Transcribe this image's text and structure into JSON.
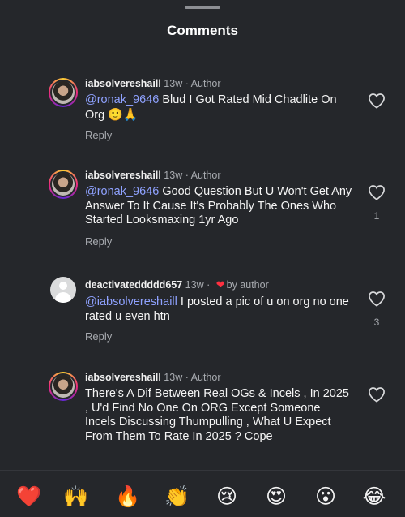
{
  "header": {
    "title": "Comments"
  },
  "comments": [
    {
      "user": "iabsolvereshaill",
      "time": "13w",
      "sep": " · ",
      "badge": "Author",
      "mention": "@ronak_9646",
      "body": " Blud I Got Rated Mid Chadlite On Org ",
      "emoji": "🙂🙏",
      "reply": "Reply",
      "likes": ""
    },
    {
      "user": "iabsolvereshaill",
      "time": "13w",
      "sep": " · ",
      "badge": "Author",
      "mention": "@ronak_9646",
      "body": " Good Question But U Won't Get Any Answer To It Cause It's Probably The Ones Who Started Looksmaxing 1yr Ago",
      "emoji": "",
      "reply": "Reply",
      "likes": "1"
    },
    {
      "user": "deactivateddddd657",
      "time": "13w",
      "sep": " · ",
      "badge": "by author",
      "mention": "@iabsolvereshaill",
      "body": " I posted a pic of u on org no one rated u even htn",
      "emoji": "",
      "reply": "Reply",
      "likes": "3"
    },
    {
      "user": "iabsolvereshaill",
      "time": "13w",
      "sep": " · ",
      "badge": "Author",
      "mention": "",
      "body": "There's A Dif Between Real OGs & Incels , In 2025 , U'd Find No One On ORG Except Someone Incels Discussing Thumpulling , What U Expect From Them To Rate In 2025 ? Cope",
      "emoji": "",
      "reply": "",
      "likes": ""
    }
  ],
  "reactions": [
    "❤️",
    "🙌",
    "🔥",
    "👏",
    "😢",
    "😍",
    "😮",
    "😂"
  ],
  "colors": {
    "background": "#25272b",
    "mention": "#8fa2ff",
    "heart_badge": "#ff3040",
    "secondary_text": "#a8abb0"
  },
  "icons": {
    "like": "heart-outline-icon",
    "liked_by_author": "heart-filled-icon",
    "default_avatar": "default-avatar-icon"
  }
}
